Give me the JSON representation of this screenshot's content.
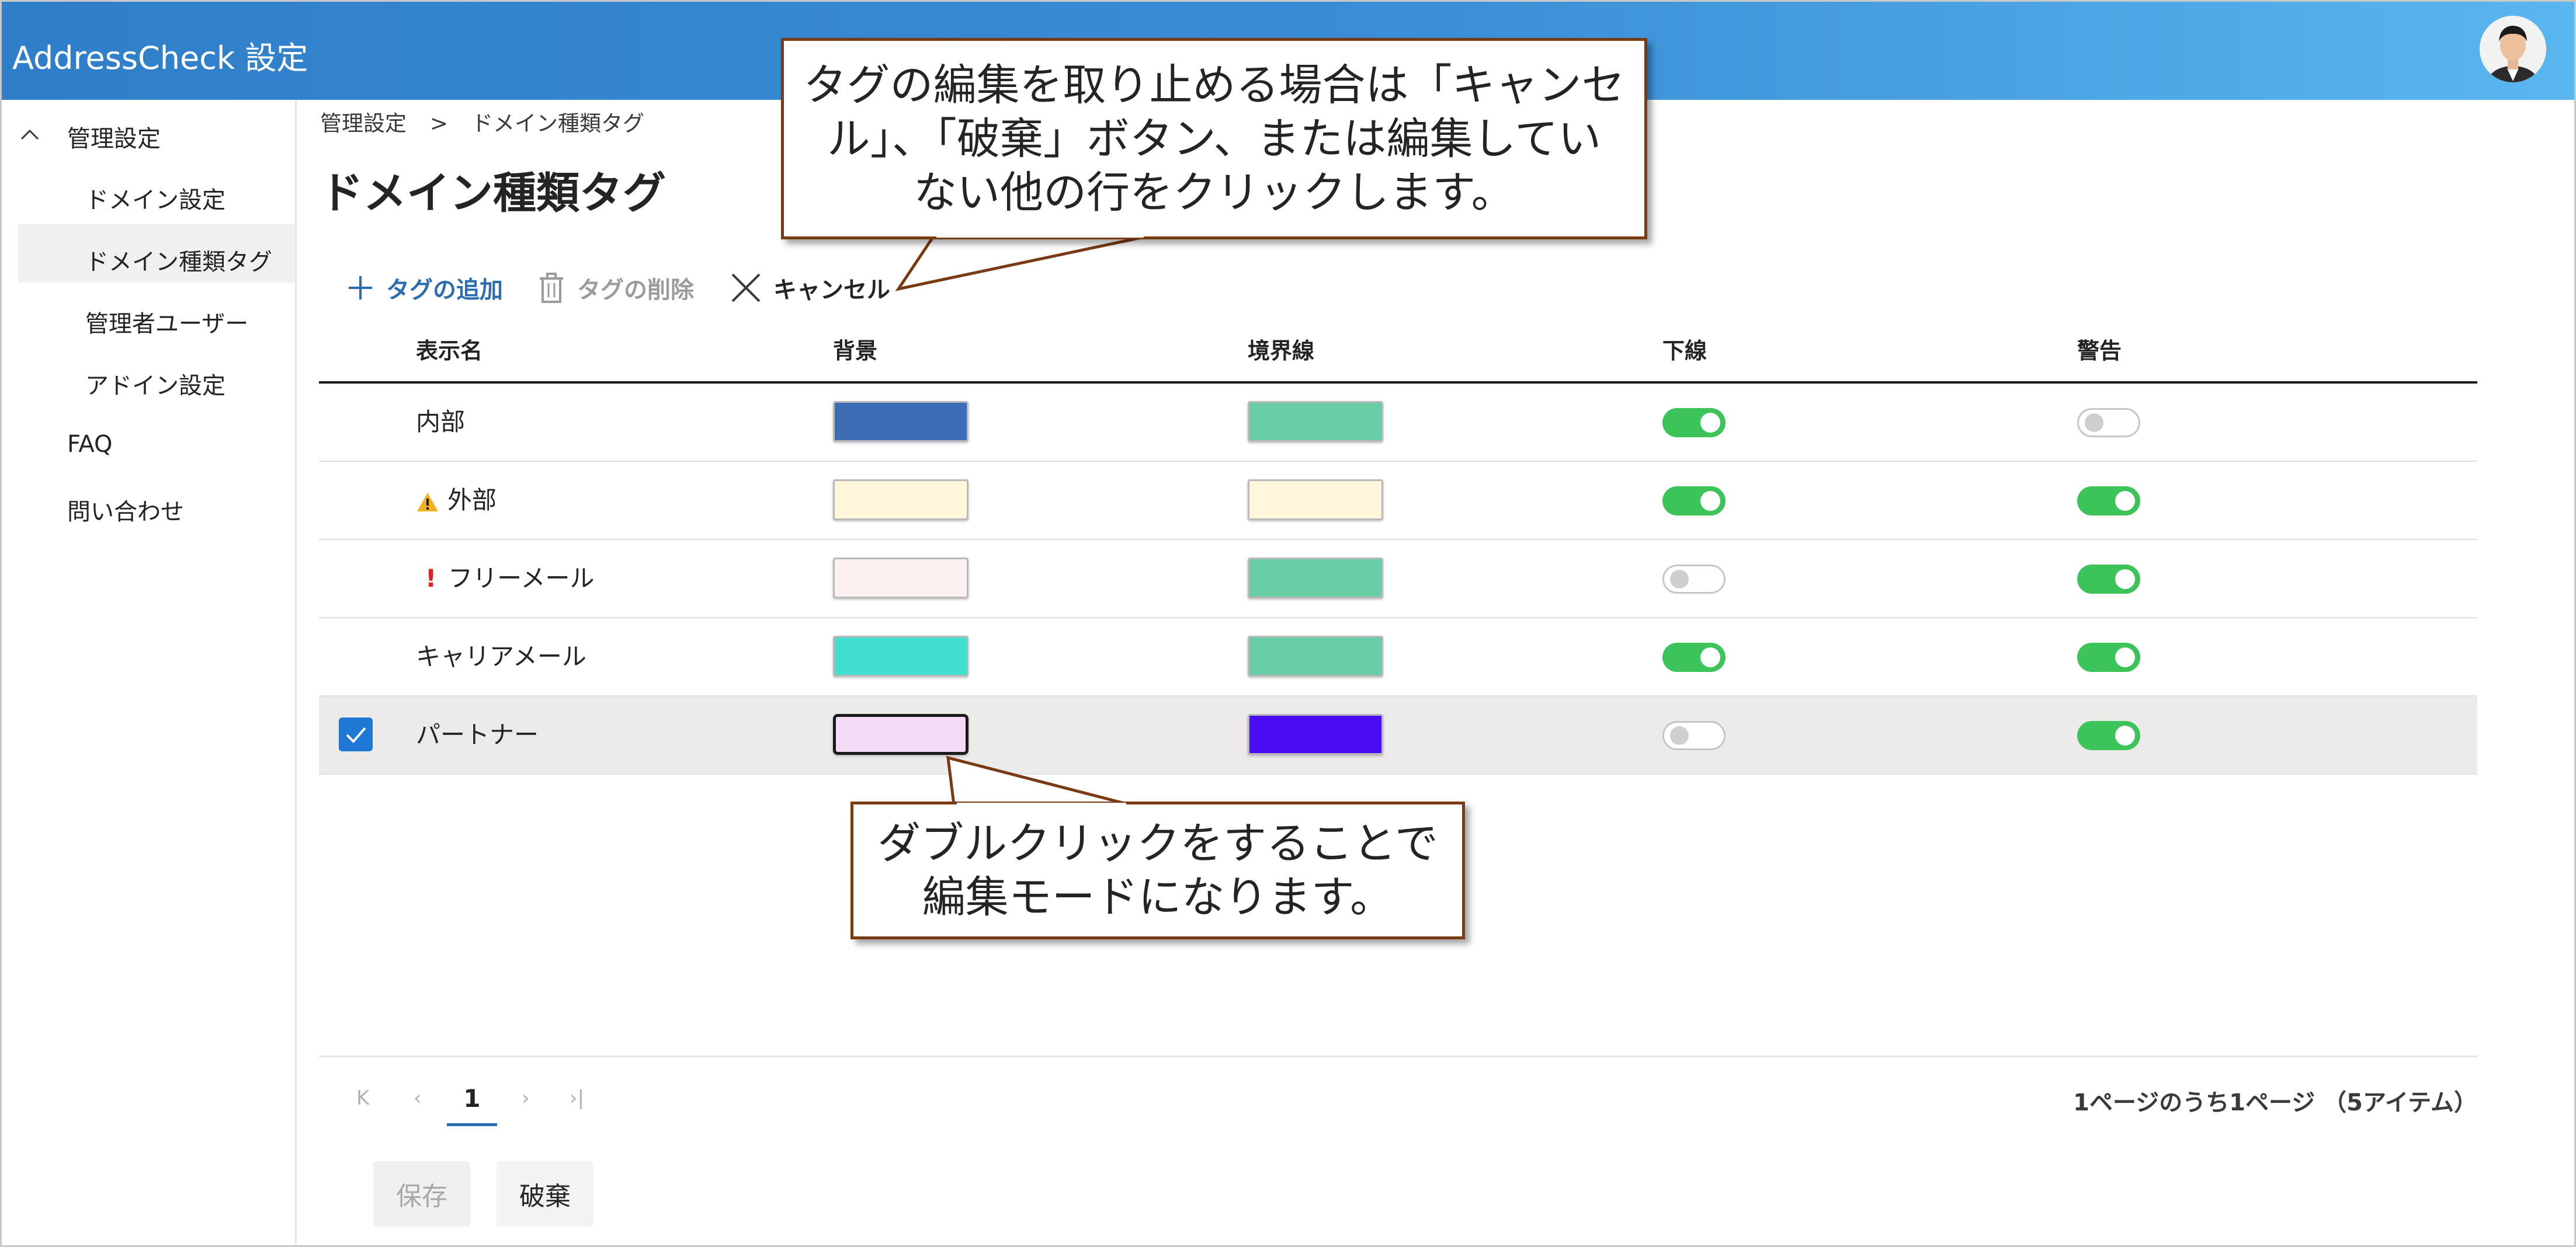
{
  "app": {
    "title": "AddressCheck 設定"
  },
  "sidebar": {
    "group_label": "管理設定",
    "items": [
      {
        "label": "ドメイン設定"
      },
      {
        "label": "ドメイン種類タグ",
        "selected": true
      },
      {
        "label": "管理者ユーザー"
      },
      {
        "label": "アドイン設定"
      }
    ],
    "faq_label": "FAQ",
    "contact_label": "問い合わせ"
  },
  "breadcrumb": {
    "parent": "管理設定",
    "separator": ">",
    "current": "ドメイン種類タグ"
  },
  "page": {
    "title": "ドメイン種類タグ"
  },
  "toolbar": {
    "add_label": "タグの追加",
    "delete_label": "タグの削除",
    "cancel_label": "キャンセル"
  },
  "table": {
    "headers": {
      "name": "表示名",
      "background": "背景",
      "border": "境界線",
      "underline": "下線",
      "warning": "警告"
    },
    "rows": [
      {
        "name": "内部",
        "icon": "none",
        "background": "#3d6db5",
        "border": "#69cda5",
        "underline": true,
        "warning": false,
        "selected": false
      },
      {
        "name": "外部",
        "icon": "warning-icon",
        "background": "#fff6dc",
        "border": "#fff6dc",
        "underline": true,
        "warning": true,
        "selected": false
      },
      {
        "name": "フリーメール",
        "icon": "exclamation-icon",
        "icon_text": "!",
        "background": "#fcf0f0",
        "border": "#69cda5",
        "underline": false,
        "warning": true,
        "selected": false
      },
      {
        "name": "キャリアメール",
        "icon": "none",
        "background": "#41dfcf",
        "border": "#69cda5",
        "underline": true,
        "warning": true,
        "selected": false
      },
      {
        "name": "パートナー",
        "icon": "none",
        "background": "#f4dcf6",
        "border": "#4a0bf5",
        "underline": false,
        "warning": true,
        "selected": true
      }
    ]
  },
  "pagination": {
    "current_page": "1",
    "summary": "1ページのうち1ページ （5アイテム）"
  },
  "footer": {
    "save_label": "保存",
    "discard_label": "破棄"
  },
  "callouts": {
    "top": [
      "タグの編集を取り止める場合は「キャンセ",
      "ル」、「破棄」ボタン、または編集してい",
      "ない他の行をクリックします。"
    ],
    "bottom": [
      "ダブルクリックをすることで",
      "編集モードになります。"
    ]
  },
  "colors": {
    "accent": "#2b6cb0",
    "toggle_on": "#3cc45a",
    "header_start": "#2f7ec9",
    "header_end": "#5ab6ef",
    "callout_border": "#7a3b14"
  }
}
